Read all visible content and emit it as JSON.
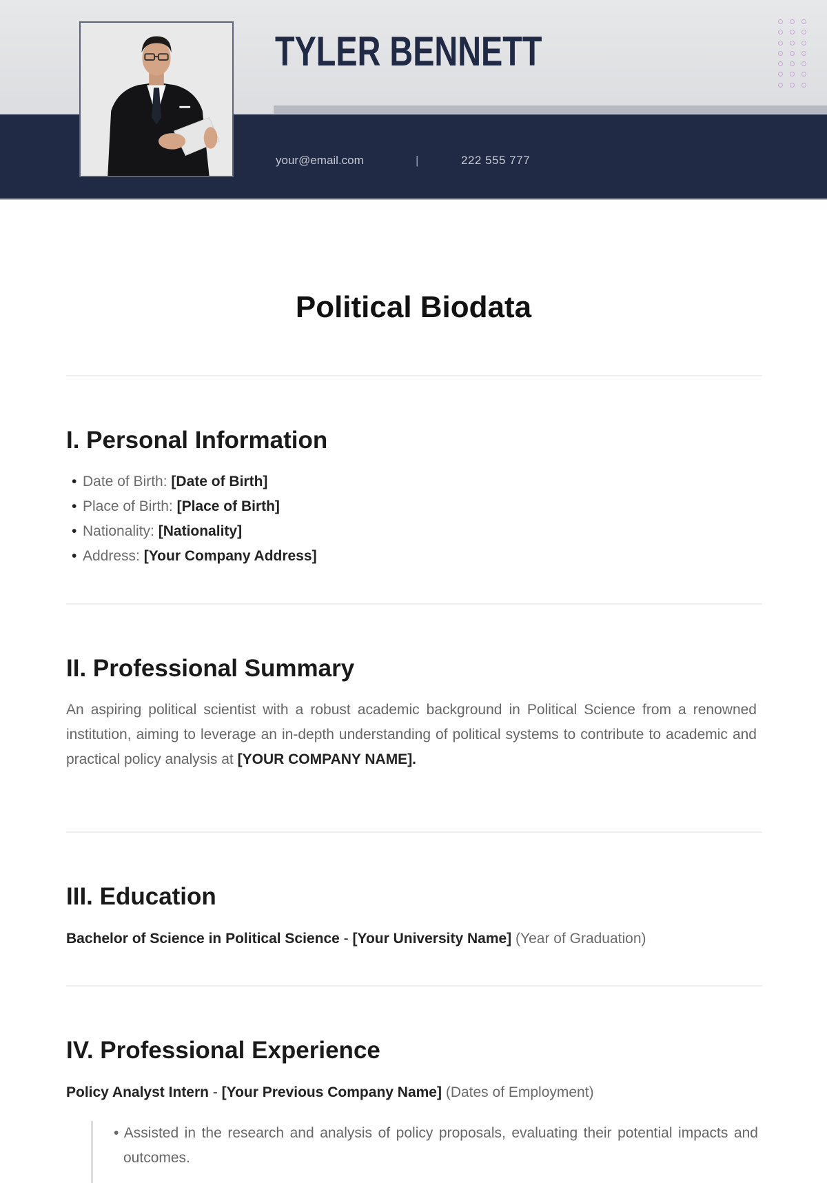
{
  "header": {
    "name": "TYLER BENNETT",
    "email": "your@email.com",
    "separator": "|",
    "phone": "222 555 777",
    "photo_alt": "Portrait of a man in a black suit holding a tablet",
    "colors": {
      "navy": "#212a45",
      "light_gray": "#e3e4e6",
      "dot_accent": "#c6a6d3"
    }
  },
  "document": {
    "title": "Political Biodata"
  },
  "sections": {
    "personal": {
      "title": "I. Personal Information",
      "items": [
        {
          "bullet": "•",
          "label": "Date of Birth:",
          "value": "[Date of Birth]"
        },
        {
          "bullet": "•",
          "label": "Place of Birth:",
          "value": "[Place of Birth]"
        },
        {
          "bullet": "•",
          "label": "Nationality:",
          "value": "[Nationality]"
        },
        {
          "bullet": "•",
          "label": "Address:",
          "value": "[Your Company Address]"
        }
      ]
    },
    "summary": {
      "title": "II. Professional Summary",
      "text": "An aspiring political scientist with a robust academic background in Political Science from a renowned institution, aiming to leverage an in-depth understanding of political systems to contribute to academic and practical policy analysis at",
      "emphasis": "[YOUR COMPANY NAME]."
    },
    "education": {
      "title": "III. Education",
      "degree": "Bachelor of Science in Political Science",
      "dash": " - ",
      "institution": "[Your University Name]",
      "year": "(Year of Graduation)"
    },
    "experience": {
      "title": "IV. Professional Experience",
      "role": "Policy Analyst Intern",
      "dash": " - ",
      "company": "[Your Previous Company Name]",
      "dates": "(Dates of Employment)",
      "bullets": [
        {
          "bullet": "•",
          "text": "Assisted in the research and analysis of policy proposals, evaluating their potential impacts and outcomes."
        }
      ]
    }
  }
}
